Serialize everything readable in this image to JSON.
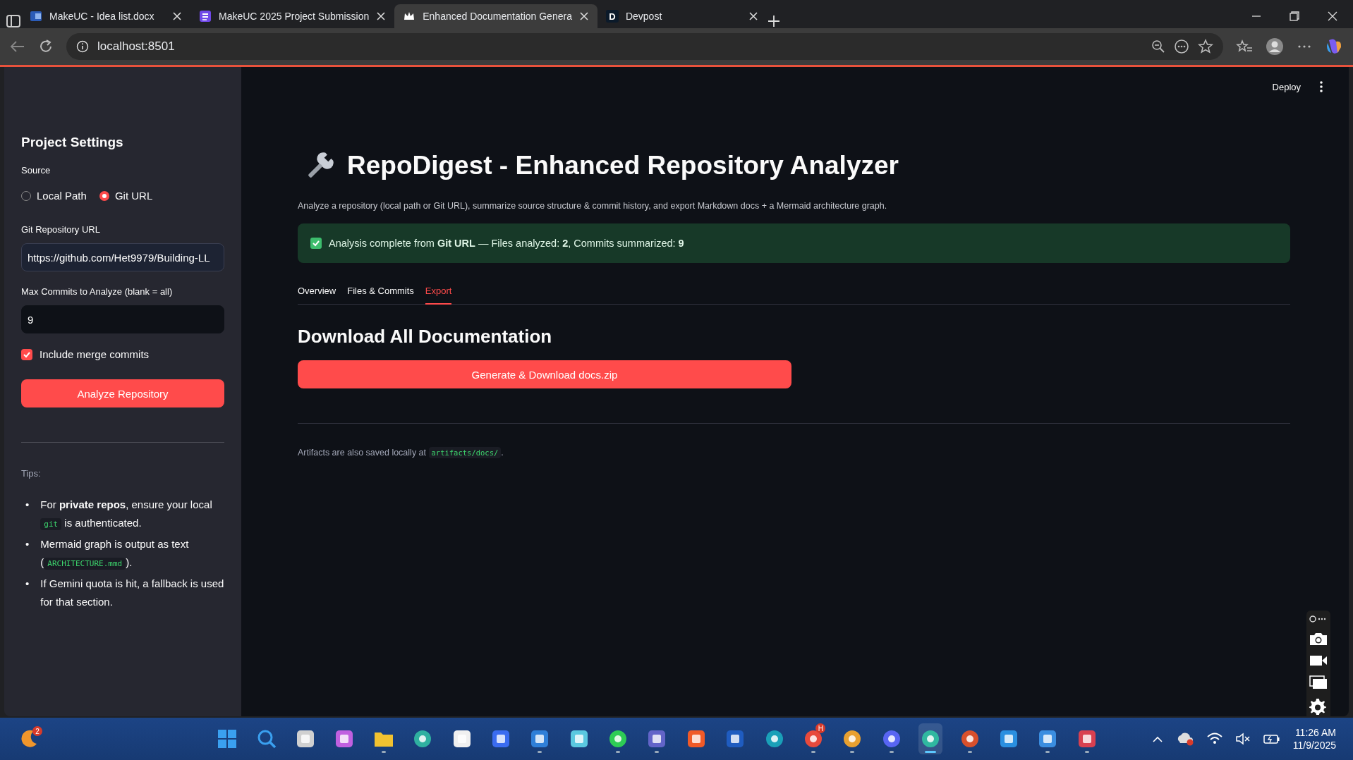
{
  "browser": {
    "tabs": [
      {
        "title": "MakeUC - Idea list.docx",
        "kind": "word",
        "selected": false
      },
      {
        "title": "MakeUC 2025 Project Submission",
        "kind": "form",
        "selected": false
      },
      {
        "title": "Enhanced Documentation Genera",
        "kind": "crown",
        "selected": true
      },
      {
        "title": "Devpost",
        "kind": "letter",
        "letter": "D",
        "selected": false
      }
    ],
    "address": "localhost:8501"
  },
  "sidebar": {
    "title": "Project Settings",
    "source_label": "Source",
    "source_options": [
      {
        "label": "Local Path",
        "selected": false
      },
      {
        "label": "Git URL",
        "selected": true
      }
    ],
    "url_label": "Git Repository URL",
    "url_value": "https://github.com/Het9979/Building-LL",
    "commits_label": "Max Commits to Analyze (blank = all)",
    "commits_value": "9",
    "merge": {
      "label": "Include merge commits",
      "checked": true
    },
    "analyze_button": "Analyze Repository",
    "tips_label": "Tips:",
    "tips": [
      {
        "marker": "•",
        "parts": [
          {
            "text": "For **private repos**, ensure your local "
          },
          {
            "code": "git"
          },
          {
            "text": " is authenticated."
          }
        ]
      },
      {
        "marker": "•",
        "parts": [
          {
            "text": "Mermaid graph is output as text ("
          },
          {
            "code": "ARCHITECTURE.mmd"
          },
          {
            "text": ")."
          }
        ]
      },
      {
        "marker": "•",
        "parts": [
          {
            "text": "If Gemini quota is hit, a fallback is used for that section."
          }
        ]
      }
    ]
  },
  "header": {
    "deploy": "Deploy"
  },
  "main": {
    "title": "RepoDigest - Enhanced Repository Analyzer",
    "description": "Analyze a repository (local path or Git URL), summarize source structure & commit history, and export Markdown docs + a Mermaid architecture graph.",
    "success": "Analysis complete from **Git URL** — Files analyzed: **2**, Commits summarized: **9**",
    "tabs": [
      {
        "label": "Overview",
        "selected": false
      },
      {
        "label": "Files & Commits",
        "selected": false
      },
      {
        "label": "Export",
        "selected": true
      }
    ],
    "section_title": "Download All Documentation",
    "download_button": "Generate & Download docs.zip",
    "artifacts": [
      {
        "text": "Artifacts are also saved locally at "
      },
      {
        "code": "artifacts/docs/"
      },
      {
        "text": "."
      }
    ]
  },
  "taskbar": {
    "start_badge": "2",
    "apps": [
      {
        "kind": "windows",
        "color": "#3aa0f0",
        "running": false,
        "selected": false
      },
      {
        "kind": "search",
        "color": "#3aa0f0",
        "running": false,
        "selected": false
      },
      {
        "kind": "square",
        "color": "#d0d0d0",
        "running": false,
        "selected": false
      },
      {
        "kind": "square",
        "color": "#c060e0",
        "running": false,
        "selected": false
      },
      {
        "kind": "folder",
        "color": "#f2c230",
        "running": true,
        "selected": false
      },
      {
        "kind": "circle",
        "color": "#2fb0a0",
        "running": false,
        "selected": false
      },
      {
        "kind": "square",
        "color": "#f0f0f0",
        "running": false,
        "selected": false
      },
      {
        "kind": "square",
        "color": "#3b6cf0",
        "running": false,
        "selected": false
      },
      {
        "kind": "square",
        "color": "#2f7fd8",
        "running": true,
        "selected": false
      },
      {
        "kind": "square",
        "color": "#5ac8e0",
        "running": false,
        "selected": false
      },
      {
        "kind": "circle",
        "color": "#2ecc55",
        "running": true,
        "selected": false
      },
      {
        "kind": "square",
        "color": "#6264c8",
        "running": true,
        "selected": false
      },
      {
        "kind": "square",
        "color": "#f05a28",
        "running": false,
        "selected": false
      },
      {
        "kind": "square",
        "color": "#1f5cc0",
        "running": false,
        "selected": false
      },
      {
        "kind": "circle",
        "color": "#1aa0b8",
        "running": false,
        "selected": false
      },
      {
        "kind": "circle",
        "color": "#e84a3c",
        "running": true,
        "selected": false,
        "badge": "H"
      },
      {
        "kind": "circle",
        "color": "#e8a030",
        "running": true,
        "selected": false
      },
      {
        "kind": "circle",
        "color": "#5865f2",
        "running": true,
        "selected": false
      },
      {
        "kind": "circle",
        "color": "#30b8a0",
        "running": true,
        "selected": true
      },
      {
        "kind": "circle",
        "color": "#d8502c",
        "running": true,
        "selected": false
      },
      {
        "kind": "square",
        "color": "#2a8fe0",
        "running": false,
        "selected": false
      },
      {
        "kind": "square",
        "color": "#3a8de0",
        "running": true,
        "selected": false
      },
      {
        "kind": "square",
        "color": "#d84050",
        "running": true,
        "selected": false
      }
    ],
    "time": "11:26 AM",
    "date": "11/9/2025"
  }
}
